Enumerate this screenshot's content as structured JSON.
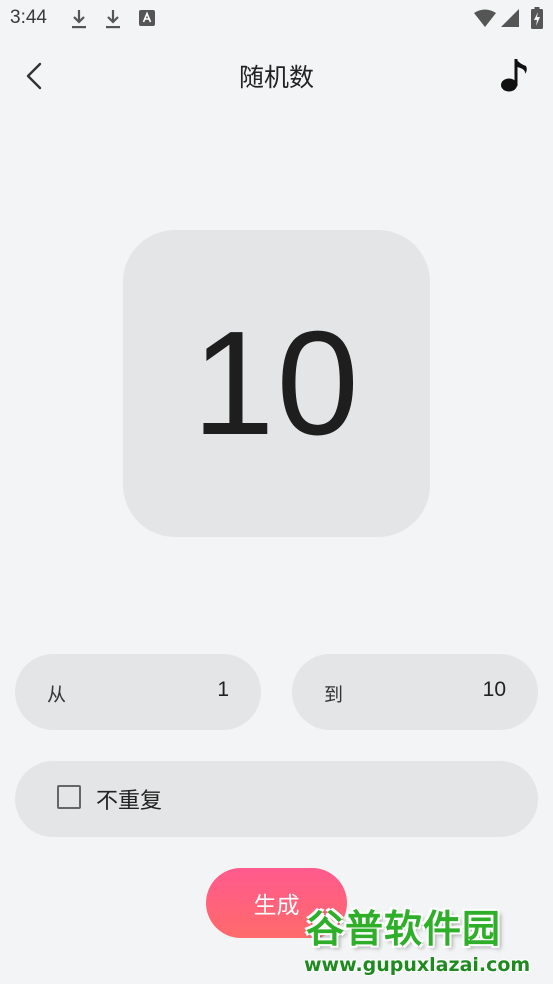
{
  "status_bar": {
    "time": "3:44",
    "left_icons": [
      "download-icon",
      "download-icon",
      "keyboard-a-icon"
    ],
    "right_icons": [
      "wifi-icon",
      "cell-signal-icon",
      "battery-charging-icon"
    ]
  },
  "header": {
    "title": "随机数",
    "back_icon": "chevron-left-icon",
    "music_icon": "music-note-icon"
  },
  "result": {
    "value": "10"
  },
  "range": {
    "from_label": "从",
    "from_value": "1",
    "to_label": "到",
    "to_value": "10"
  },
  "options": {
    "no_repeat_label": "不重复",
    "no_repeat_checked": false
  },
  "actions": {
    "generate_label": "生成"
  },
  "watermark": {
    "title": "谷普软件园",
    "url": "www.gupuxlazai.com"
  },
  "colors": {
    "background": "#f2f4f5",
    "card": "#e3e5e6",
    "button_gradient_top": "#ff5a8e",
    "button_gradient_bottom": "#ff6a6a"
  }
}
